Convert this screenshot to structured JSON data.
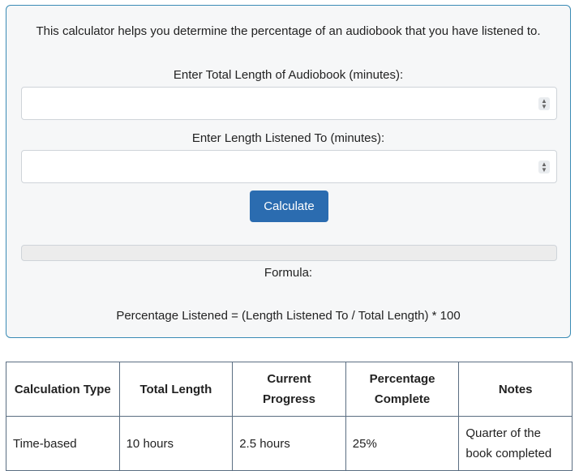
{
  "calculator": {
    "intro": "This calculator helps you determine the percentage of an audiobook that you have listened to.",
    "total_label": "Enter Total Length of Audiobook (minutes):",
    "total_value": "",
    "listened_label": "Enter Length Listened To (minutes):",
    "listened_value": "",
    "calculate_label": "Calculate",
    "result_text": "",
    "formula_label": "Formula:",
    "formula_text": "Percentage Listened = (Length Listened To / Total Length) * 100"
  },
  "table": {
    "headers": [
      "Calculation Type",
      "Total Length",
      "Current Progress",
      "Percentage Complete",
      "Notes"
    ],
    "rows": [
      [
        "Time-based",
        "10 hours",
        "2.5 hours",
        "25%",
        "Quarter of the book completed"
      ]
    ]
  },
  "colors": {
    "accent": "#2b6cb0",
    "card_border": "#3a8bb5",
    "card_background": "#f6f7f8",
    "table_border": "#5b6e82"
  }
}
